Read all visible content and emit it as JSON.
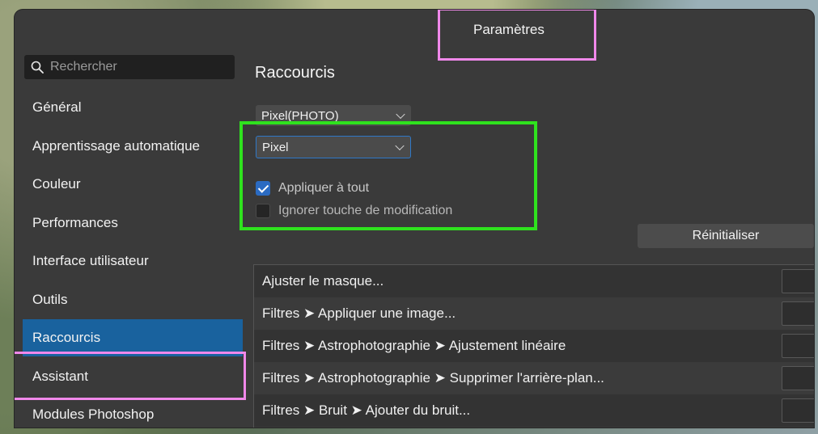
{
  "window": {
    "title": "Paramètres"
  },
  "sidebar": {
    "search_placeholder": "Rechercher",
    "items": [
      {
        "label": "Général"
      },
      {
        "label": "Apprentissage automatique"
      },
      {
        "label": "Couleur"
      },
      {
        "label": "Performances"
      },
      {
        "label": "Interface utilisateur"
      },
      {
        "label": "Outils"
      },
      {
        "label": "Raccourcis",
        "active": true
      },
      {
        "label": "Assistant"
      },
      {
        "label": "Modules Photoshop"
      }
    ]
  },
  "main": {
    "section_title": "Raccourcis",
    "persona_dropdown": {
      "value": "Pixel(PHOTO)"
    },
    "studio_dropdown": {
      "value": "Pixel"
    },
    "apply_all": {
      "label": "Appliquer à tout",
      "checked": true
    },
    "ignore_modifier": {
      "label": "Ignorer touche de modification",
      "checked": false
    },
    "reset_label": "Réinitialiser",
    "shortcut_rows": [
      {
        "label": "Ajuster le masque..."
      },
      {
        "label": "Filtres ➤ Appliquer une image..."
      },
      {
        "label": "Filtres ➤ Astrophotographie ➤ Ajustement linéaire"
      },
      {
        "label": "Filtres ➤ Astrophotographie ➤ Supprimer l'arrière-plan..."
      },
      {
        "label": "Filtres ➤ Bruit ➤ Ajouter du bruit..."
      }
    ]
  },
  "colors": {
    "active_nav": "#19629e",
    "highlight_pink": "#f088ea",
    "highlight_green": "#2fe21e",
    "checkbox_blue": "#2b6bc2"
  }
}
